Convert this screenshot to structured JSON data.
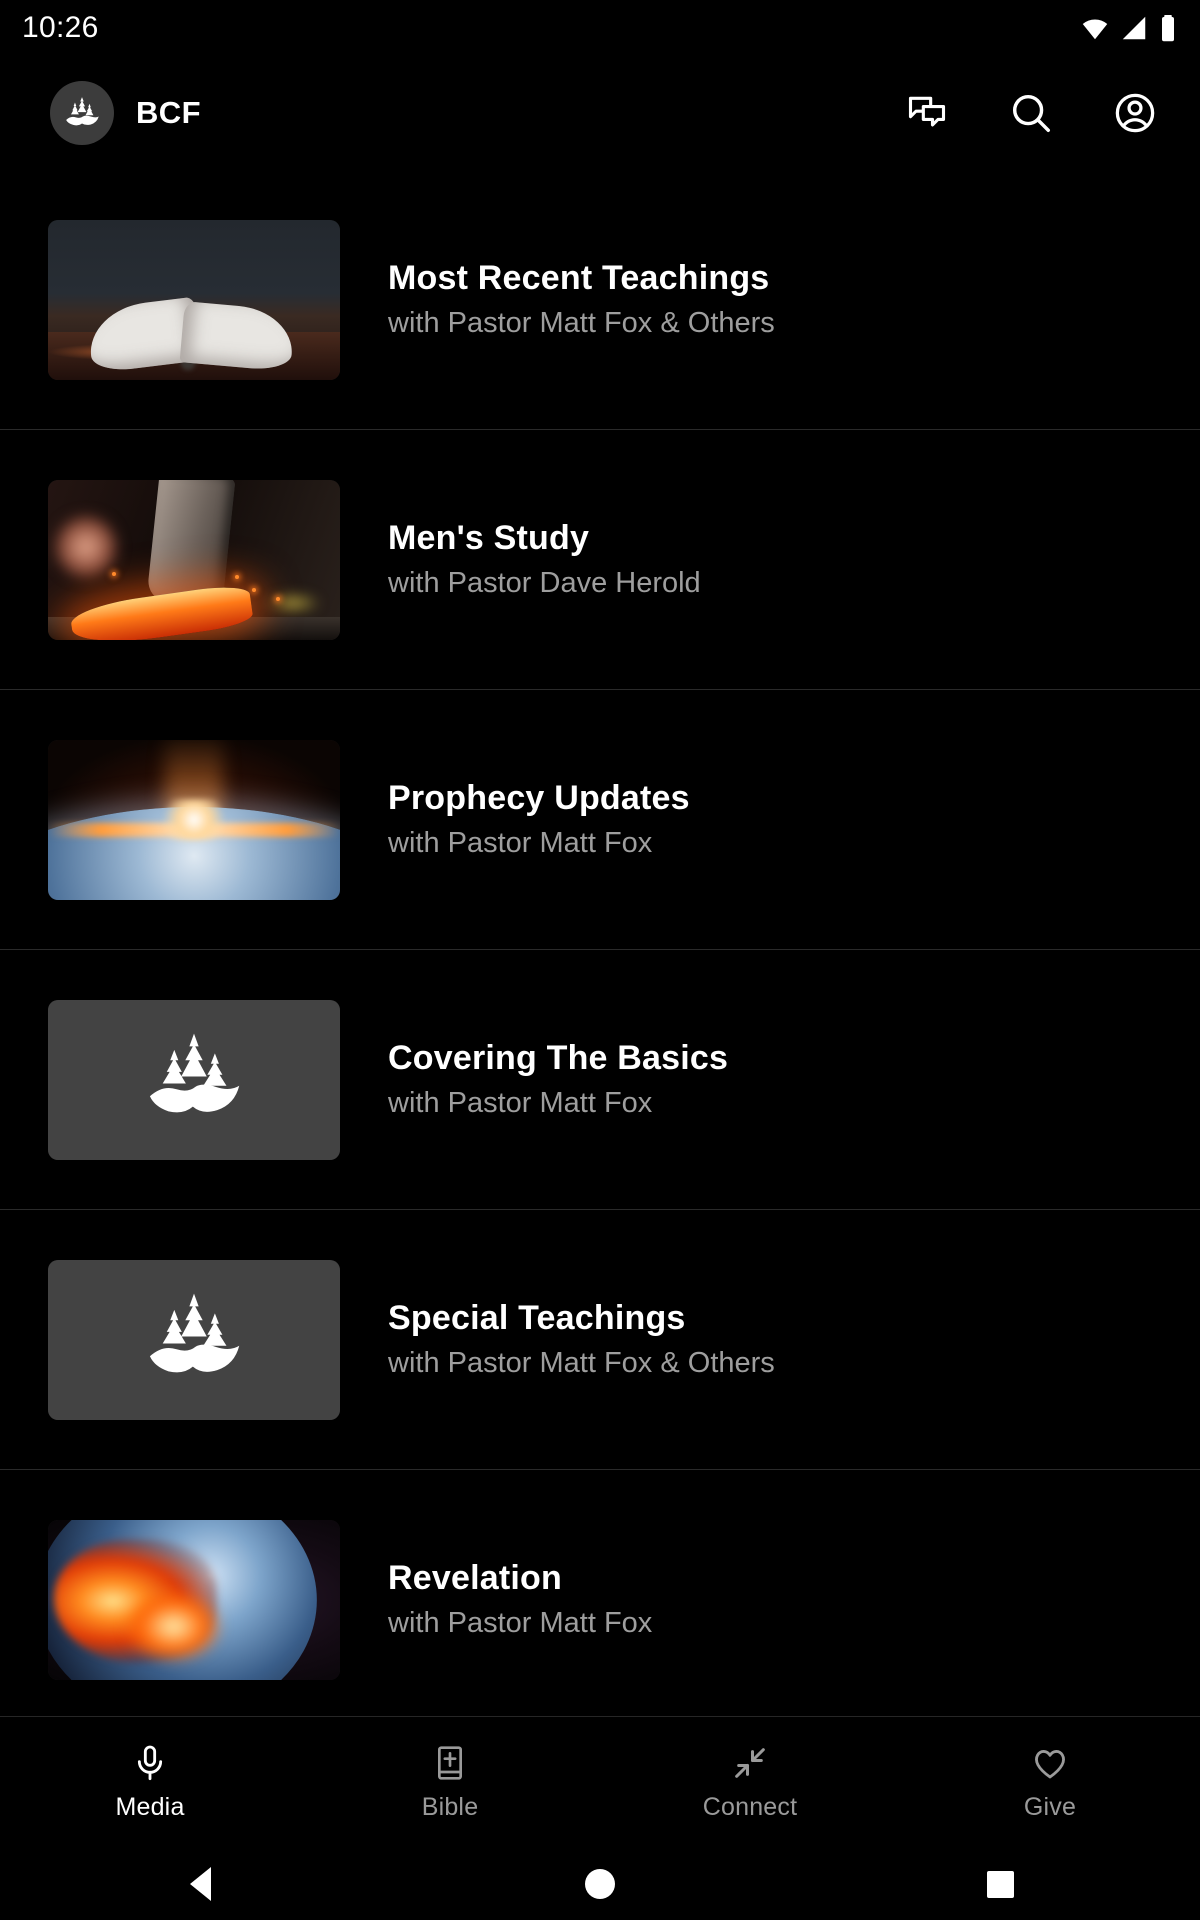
{
  "status_bar": {
    "time": "10:26",
    "icons": [
      "wifi-icon",
      "cellular-signal-icon",
      "battery-icon"
    ]
  },
  "app_bar": {
    "brand_title": "BCF",
    "brand_logo_icon": "bcf-pine-trees-logo",
    "actions": [
      {
        "name": "messages-icon",
        "label": "Messages"
      },
      {
        "name": "search-icon",
        "label": "Search"
      },
      {
        "name": "account-icon",
        "label": "Account"
      }
    ]
  },
  "media_list": {
    "items": [
      {
        "title": "Most Recent Teachings",
        "subtitle": "with Pastor Matt Fox & Others",
        "thumb": "open-bible-book",
        "thumb_kind": "photo"
      },
      {
        "title": "Men's Study",
        "subtitle": "with Pastor Dave Herold",
        "thumb": "blacksmith-forge-hammer",
        "thumb_kind": "photo"
      },
      {
        "title": "Prophecy Updates",
        "subtitle": "with Pastor Matt Fox",
        "thumb": "sunrise-over-earth",
        "thumb_kind": "photo"
      },
      {
        "title": "Covering The Basics",
        "subtitle": "with Pastor Matt Fox",
        "thumb": "bcf-pine-trees-logo",
        "thumb_kind": "logo"
      },
      {
        "title": "Special Teachings",
        "subtitle": "with Pastor Matt Fox & Others",
        "thumb": "bcf-pine-trees-logo",
        "thumb_kind": "logo"
      },
      {
        "title": "Revelation",
        "subtitle": "with Pastor Matt Fox",
        "thumb": "fiery-earth",
        "thumb_kind": "photo"
      }
    ]
  },
  "bottom_nav": {
    "items": [
      {
        "label": "Media",
        "icon": "microphone-icon",
        "active": true
      },
      {
        "label": "Bible",
        "icon": "bible-book-icon",
        "active": false
      },
      {
        "label": "Connect",
        "icon": "connect-arrows-icon",
        "active": false
      },
      {
        "label": "Give",
        "icon": "heart-icon",
        "active": false
      }
    ]
  },
  "system_nav": {
    "back": "back-triangle-icon",
    "home": "home-circle-icon",
    "recents": "recents-square-icon"
  },
  "colors": {
    "background": "#000000",
    "surface": "#434343",
    "text_primary": "#ffffff",
    "text_secondary": "#9e9e9e",
    "divider": "#2a2a2a"
  }
}
